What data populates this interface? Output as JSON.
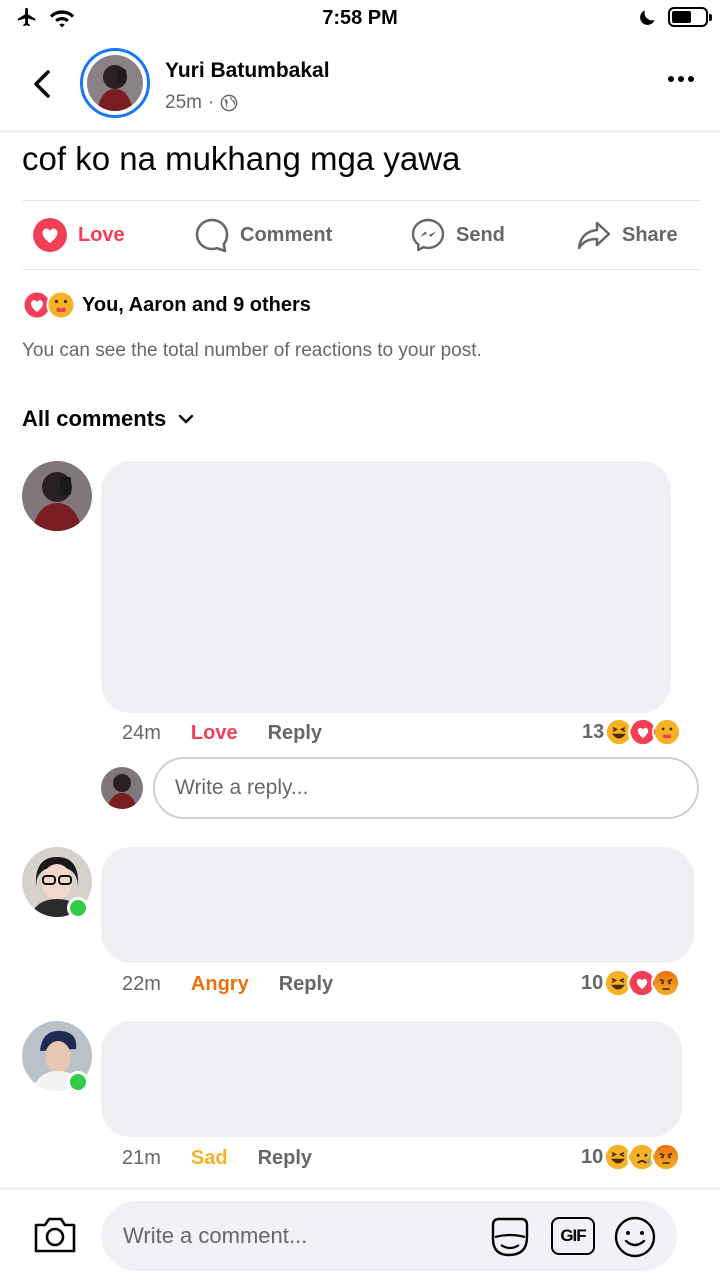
{
  "status_bar": {
    "time": "7:58 PM"
  },
  "post": {
    "author": "Yuri Batumbakal",
    "time": "25m",
    "separator": "·",
    "text": "cof ko na mukhang mga yawa"
  },
  "actions": {
    "love": "Love",
    "comment": "Comment",
    "send": "Send",
    "share": "Share"
  },
  "reactions": {
    "summary": "You, Aaron and 9 others",
    "note": "You can see the total number of reactions to your post."
  },
  "comments_filter": "All comments",
  "comments": [
    {
      "time": "24m",
      "reaction": "Love",
      "reply_label": "Reply",
      "count": "13",
      "reaction_icons": [
        "haha",
        "love",
        "care"
      ]
    },
    {
      "time": "22m",
      "reaction": "Angry",
      "reply_label": "Reply",
      "count": "10",
      "reaction_icons": [
        "haha",
        "love",
        "angry"
      ]
    },
    {
      "time": "21m",
      "reaction": "Sad",
      "reply_label": "Reply",
      "count": "10",
      "reaction_icons": [
        "haha",
        "sad",
        "angry"
      ]
    }
  ],
  "reply_box": {
    "placeholder": "Write a reply..."
  },
  "composer": {
    "placeholder": "Write a comment...",
    "gif_label": "GIF"
  },
  "colors": {
    "accent": "#1877f2",
    "love": "#f33e58",
    "angry": "#e9710f",
    "sad": "#f7b125",
    "online": "#31cc46"
  }
}
